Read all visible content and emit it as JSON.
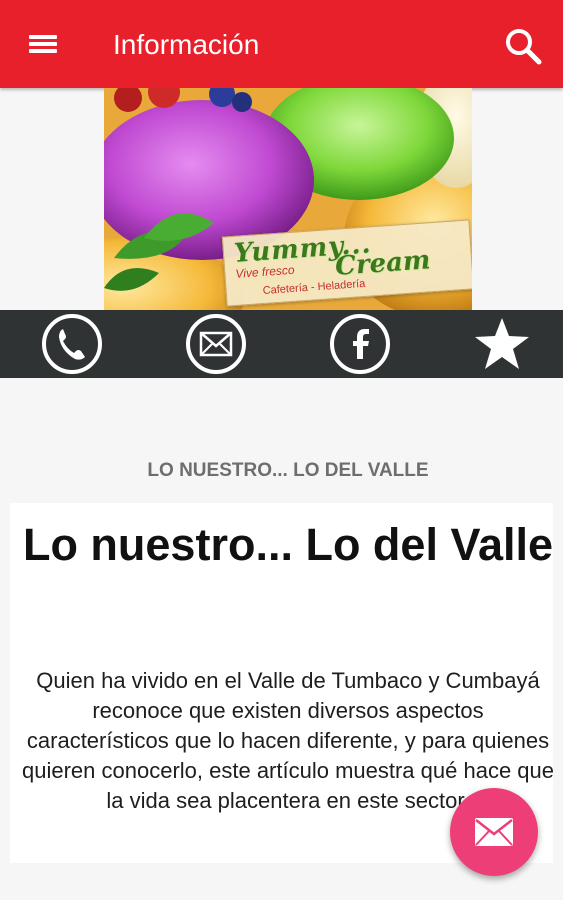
{
  "appbar": {
    "title": "Información",
    "color": "#e8202c",
    "menu_icon": "hamburger-menu-icon",
    "search_icon": "search-icon"
  },
  "banner": {
    "logo_name": "Yummy...",
    "logo_name2": "Cream",
    "logo_tagline": "Vive fresco",
    "logo_subtitle": "Cafetería - Heladería"
  },
  "actions": [
    {
      "icon": "phone-icon"
    },
    {
      "icon": "mail-icon"
    },
    {
      "icon": "facebook-icon"
    },
    {
      "icon": "star-icon"
    }
  ],
  "content": {
    "section_label": "LO NUESTRO... LO DEL VALLE",
    "title": "Lo nuestro... Lo del Valle",
    "body": "Quien ha vivido en el Valle de Tumbaco y Cumbayá reconoce que existen diversos aspectos característicos que lo hacen diferente, y para quienes quieren conocerlo, este artículo muestra qué hace que la vida sea placentera en este sector."
  },
  "fab": {
    "icon": "mail-icon",
    "color": "#ee3e77"
  }
}
